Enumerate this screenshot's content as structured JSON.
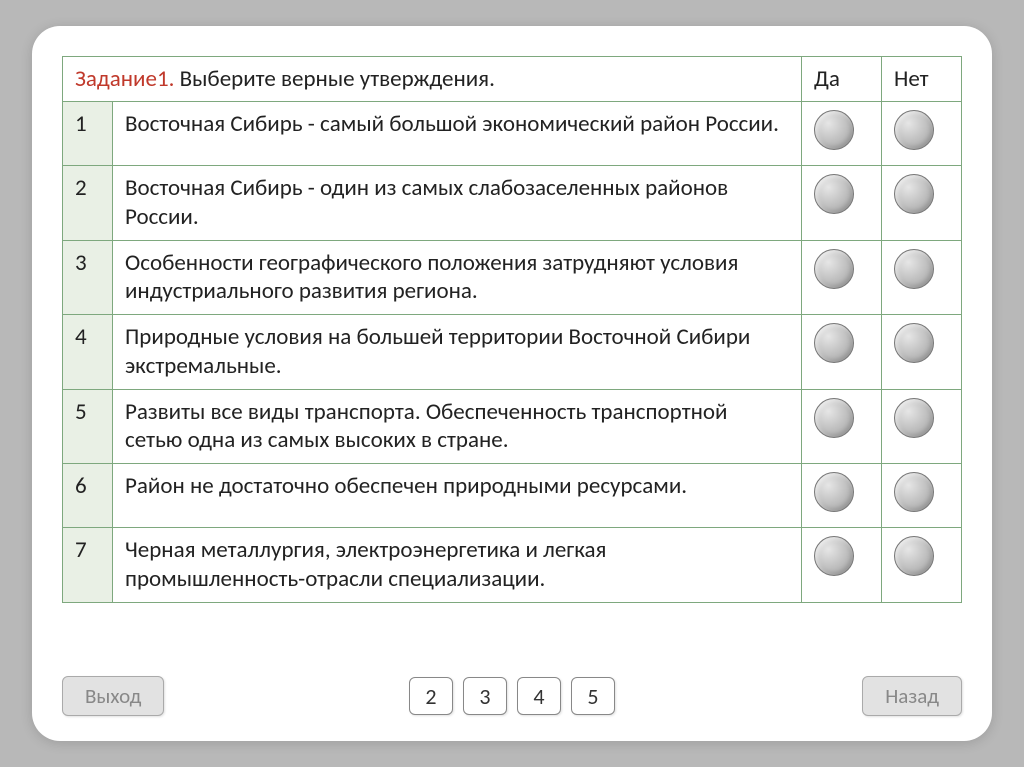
{
  "header": {
    "task_label": "Задание1.",
    "task_prompt": " Выберите верные утверждения.",
    "yes": "Да",
    "no": "Нет"
  },
  "rows": [
    {
      "num": "1",
      "text": "Восточная Сибирь - самый большой экономический район России."
    },
    {
      "num": "2",
      "text": "Восточная Сибирь - один из самых слабозаселенных районов России."
    },
    {
      "num": "3",
      "text": "Особенности географического положения затрудняют условия индустриального развития региона."
    },
    {
      "num": "4",
      "text": "Природные условия на большей территории Восточной Сибири экстремальные."
    },
    {
      "num": "5",
      "text": "Развиты все виды транспорта. Обеспеченность транспортной сетью одна из самых высоких в стране."
    },
    {
      "num": "6",
      "text": "Район не достаточно обеспечен природными ресурсами."
    },
    {
      "num": "7",
      "text": "Черная металлургия, электроэнергетика и легкая промышленность-отрасли специализации."
    }
  ],
  "pager": {
    "p2": "2",
    "p3": "3",
    "p4": "4",
    "p5": "5"
  },
  "buttons": {
    "exit": "Выход",
    "back": "Назад"
  }
}
